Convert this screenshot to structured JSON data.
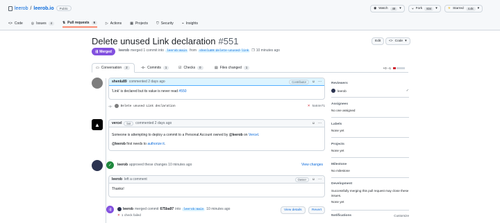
{
  "repo": {
    "owner": "leerob",
    "sep": "/",
    "name": "leerob.io",
    "visibility": "Public"
  },
  "actions": {
    "watch": "Watch",
    "watch_count": "48",
    "fork": "Fork",
    "fork_count": "834",
    "star": "Starred",
    "star_count": "4.4k"
  },
  "nav": {
    "code": "Code",
    "issues": "Issues",
    "issues_count": "4",
    "pulls": "Pull requests",
    "pulls_count": "6",
    "actions": "Actions",
    "projects": "Projects",
    "security": "Security",
    "insights": "Insights"
  },
  "pr": {
    "title": "Delete unused Link declaration",
    "number": "#551",
    "status": "Merged",
    "author": "leerob",
    "merged_text": "merged 1 commit into",
    "base": "leerob:main",
    "from": "from",
    "head": "shenlu89:delete-unused-link",
    "time": "10 minutes ago",
    "edit": "Edit",
    "code_btn": "Code"
  },
  "tabs": {
    "conversation": "Conversation",
    "conversation_count": "2",
    "commits": "Commits",
    "commits_count": "1",
    "checks": "Checks",
    "checks_count": "0",
    "files": "Files changed",
    "files_count": "1",
    "diffstat": "+0 −1"
  },
  "comment1": {
    "author": "shenlu89",
    "action": "commented 2 days ago",
    "role": "Contributor",
    "body_pre": "'Link' is declared but its value is never read",
    "body_link": "#550"
  },
  "commit": {
    "message": "Delete unused Link declaration",
    "sha": "5a84e71"
  },
  "comment2": {
    "author": "vercel",
    "bot": "bot",
    "action": "commented 2 days ago",
    "line1_pre": "Someone is attempting to deploy a commit to a Personal Account owned by",
    "line1_user": "@leerob",
    "line1_mid": "on",
    "line1_link": "Vercel",
    "line1_end": ".",
    "line2_user": "@leerob",
    "line2_mid": "first needs to",
    "line2_link": "authorize it",
    "line2_end": "."
  },
  "approval": {
    "author": "leerob",
    "action": "approved these changes 10 minutes ago",
    "view": "View changes"
  },
  "comment3": {
    "author": "leerob",
    "action": "left a comment",
    "role": "Owner",
    "body": "Thanks!"
  },
  "merge_event": {
    "author": "leerob",
    "action": "merged commit",
    "sha": "675ba97",
    "into": "into",
    "base": "leerob:main",
    "time": "10 minutes ago",
    "checks": "1 check failed",
    "view_details": "View details",
    "revert": "Revert"
  },
  "sidebar": {
    "reviewers": "Reviewers",
    "reviewer": "leerob",
    "assignees": "Assignees",
    "assignees_val": "No one assigned",
    "labels": "Labels",
    "labels_val": "None yet",
    "projects": "Projects",
    "projects_val": "None yet",
    "milestone": "Milestone",
    "milestone_val": "No milestone",
    "development": "Development",
    "development_val": "Successfully merging this pull request may close these issues.",
    "development_none": "None yet",
    "notifications": "Notifications",
    "customize": "Customize"
  }
}
